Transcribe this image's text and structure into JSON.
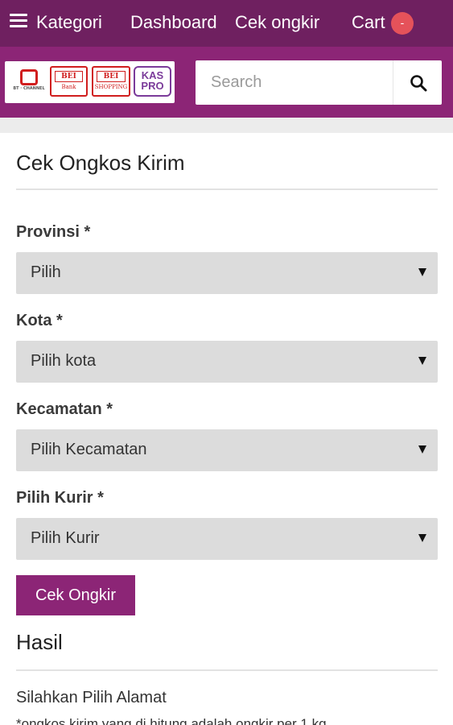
{
  "nav": {
    "kategori": "Kategori",
    "dashboard": "Dashboard",
    "cek_ongkir": "Cek ongkir",
    "cart": "Cart",
    "cart_badge": "-"
  },
  "brand": {
    "logos": [
      {
        "name": "BT-Channel",
        "text": "BT · CHANNEL"
      },
      {
        "name": "BEI Bank",
        "text": "BEI",
        "sub": "Bank"
      },
      {
        "name": "BEI Shopping",
        "text": "BEI",
        "sub": "SHOPPING"
      },
      {
        "name": "KasPro",
        "text": "KAS PRO"
      }
    ]
  },
  "search": {
    "placeholder": "Search"
  },
  "form": {
    "title": "Cek Ongkos Kirim",
    "fields": [
      {
        "label": "Provinsi *",
        "value": "Pilih"
      },
      {
        "label": "Kota *",
        "value": "Pilih kota"
      },
      {
        "label": "Kecamatan *",
        "value": "Pilih Kecamatan"
      },
      {
        "label": "Pilih Kurir *",
        "value": "Pilih Kurir"
      }
    ],
    "submit_label": "Cek Ongkir"
  },
  "result": {
    "title": "Hasil",
    "message": "Silahkan Pilih Alamat",
    "note": "*ongkos kirim yang di hitung adalah ongkir per 1 kg"
  },
  "colors": {
    "nav_bg": "#6f2060",
    "brand_bg": "#8c2576",
    "button_bg": "#8c2576",
    "badge_bg": "#e5525a"
  },
  "icons": [
    "menu-icon",
    "search-icon",
    "chevron-down-icon"
  ]
}
